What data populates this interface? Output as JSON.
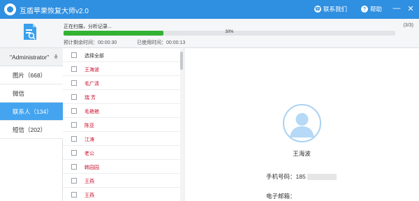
{
  "app": {
    "title": "互盾苹果恢复大师v2.0",
    "contact_label": "联系我们",
    "help_label": "帮助",
    "accent_color": "#2f8fe0"
  },
  "progress": {
    "status": "正在扫描，分析记录...",
    "count": "(3/3)",
    "percent": 30,
    "percent_label": "30%",
    "remaining": "预计剩余时间：00:00:30",
    "elapsed": "已使用时间：00:00:13",
    "fill_color": "#34b233"
  },
  "sidebar": {
    "user": "\"Administrator\"",
    "caret": "ê",
    "categories": [
      {
        "label": "图片（668）"
      },
      {
        "label": "微信"
      },
      {
        "label": "联系人（134）"
      },
      {
        "label": "短信（202）"
      }
    ],
    "active_index": 2
  },
  "contacts": {
    "select_all": "选择全部",
    "items": [
      "王海波",
      "毛广清",
      "瑞 芳",
      "毛艳艳",
      "陈亚",
      "江涛",
      "老公",
      "韩园园",
      "王燕",
      "王燕"
    ]
  },
  "detail": {
    "name": "王海波",
    "phone_label": "手机号码：",
    "phone_value": "185",
    "email_label": "电子邮箱："
  }
}
